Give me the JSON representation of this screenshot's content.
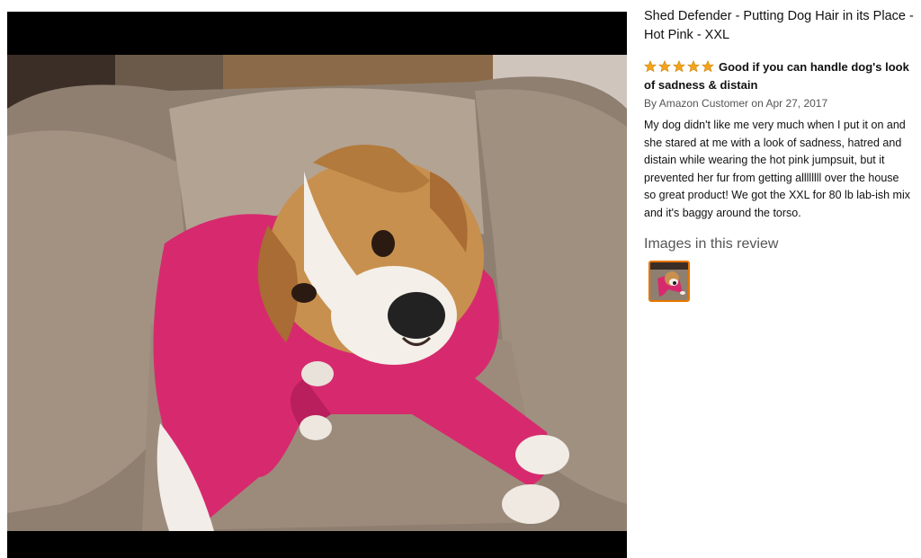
{
  "product": {
    "title": "Shed Defender - Putting Dog Hair in its Place - Hot Pink - XXL"
  },
  "review": {
    "rating": 5,
    "rating_max": 5,
    "headline": "Good if you can handle dog's look of sadness & distain",
    "by_prefix": "By",
    "author": "Amazon Customer",
    "date_prefix": "on",
    "date": "Apr 27, 2017",
    "body": "My dog didn't like me very much when I put it on and she stared at me with a look of sadness, hatred and distain while wearing the hot pink jumpsuit, but it prevented her fur from getting allllllll over the house so great product! We got the XXL for 80 lb lab-ish mix and it's baggy around the torso."
  },
  "images_section": {
    "heading": "Images in this review"
  },
  "colors": {
    "star": "#f4a41c",
    "thumb_border": "#e77600",
    "jumpsuit": "#d72a6e"
  }
}
